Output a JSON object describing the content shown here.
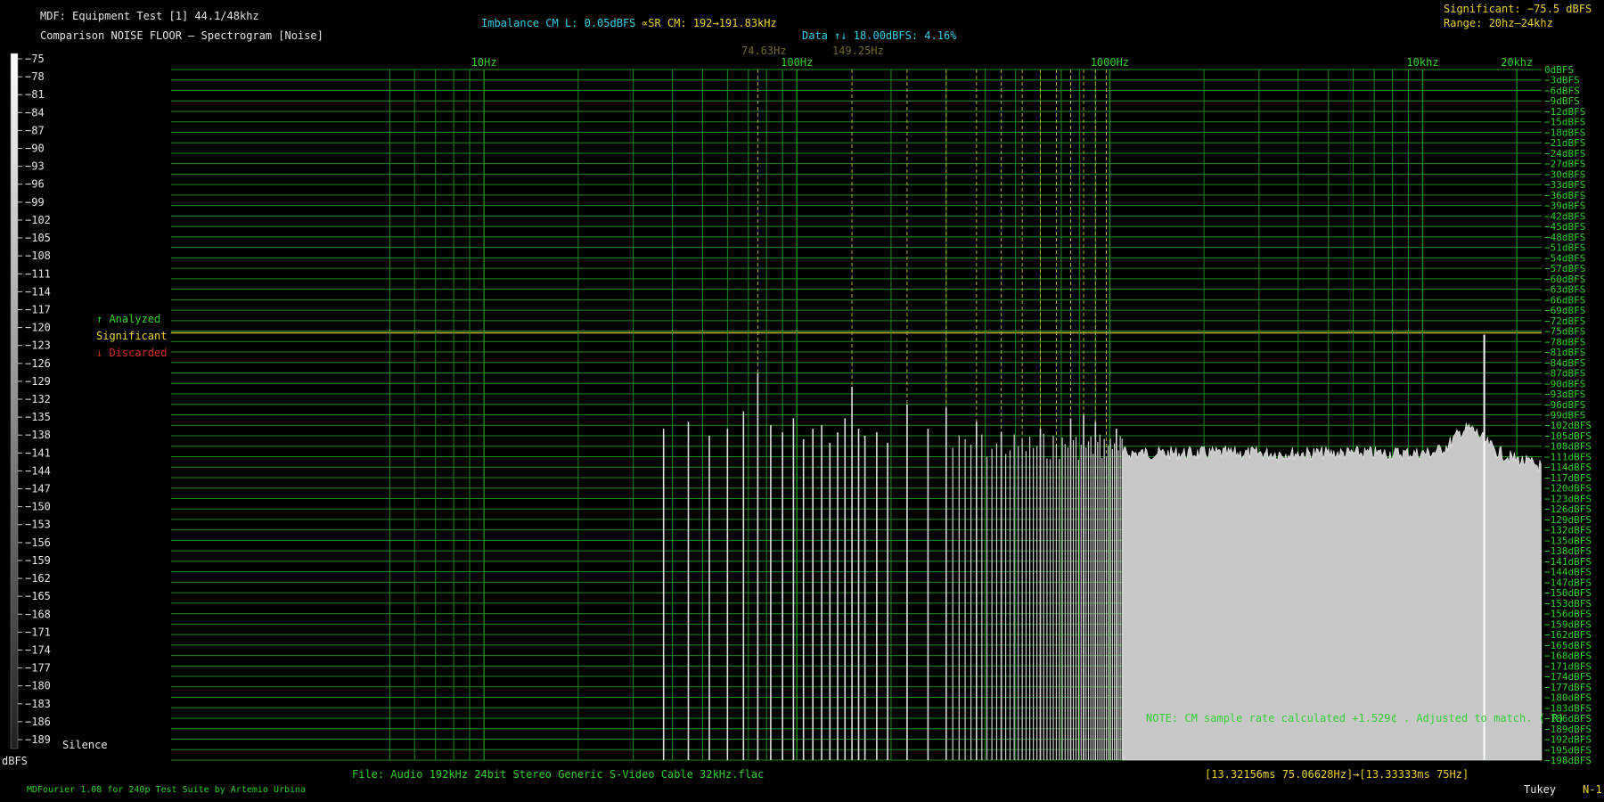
{
  "header": {
    "line1": "MDF: Equipment Test [1] 44.1/48khz",
    "line2": "Comparison NOISE FLOOR – Spectrogram [Noise]",
    "imbalance": "Imbalance CM L: 0.05dBFS",
    "sr_cm": "∝SR CM: 192→191.83kHz",
    "data_note": "Data ↑↓ 18.00dBFS: 4.16%",
    "significant": "Significant: −75.5 dBFS",
    "range": "Range: 20hz–24khz",
    "marker1": "74.63Hz",
    "marker2": "149.25Hz"
  },
  "legend": {
    "analyzed": "↑ Analyzed",
    "significant": "Significant",
    "discarded": "↓ Discarded",
    "silence": "Silence",
    "unit": "dBFS"
  },
  "footer": {
    "file": "File: Audio  192kHz 24bit Stereo Generic S-Video Cable 32kHz.flac",
    "range": "[13.32156ms 75.06628Hz]→[13.33333ms 75Hz]",
    "credit": "MDFourier 1.08 for 240p Test Suite by Artemio Urbina",
    "window": "Tukey",
    "n": "N-1",
    "note": "NOTE: CM sample rate calculated +1.529¢ . Adjusted to match. (-R)"
  },
  "colors": {
    "background": "#000000",
    "grid": "#1f8a1f",
    "axis_text": "#2ed12e",
    "significant_line": "#c8b428",
    "marker": "#b8b038",
    "spectrum": "#c8c8c8"
  },
  "chart_data": {
    "type": "bar",
    "title": "Comparison NOISE FLOOR – Spectrogram [Noise]",
    "x_scale": "log",
    "x_range_hz": [
      1,
      24000
    ],
    "x_ticks": [
      {
        "hz": 10,
        "label": "10Hz"
      },
      {
        "hz": 100,
        "label": "100Hz"
      },
      {
        "hz": 1000,
        "label": "1000Hz"
      },
      {
        "hz": 10000,
        "label": "10khz"
      },
      {
        "hz": 20000,
        "label": "20khz"
      }
    ],
    "y_range_dbfs": [
      -198,
      0
    ],
    "y_step_dbfs": 3,
    "significant_level_dbfs": -75.5,
    "marker_lines_hz": [
      75,
      150,
      225,
      300,
      375,
      450,
      525,
      600,
      675,
      750,
      825,
      900,
      975
    ],
    "color_scale_ticks": [
      "-75",
      "-78",
      "-81",
      "-84",
      "-87",
      "-90",
      "-93",
      "-96",
      "-99",
      "-102",
      "-105",
      "-108",
      "-111",
      "-114",
      "-117",
      "-120",
      "-123",
      "-126",
      "-129",
      "-132",
      "-135",
      "-138",
      "-141",
      "-144",
      "-147",
      "-150",
      "-153",
      "-156",
      "-159",
      "-162",
      "-165",
      "-168",
      "-171",
      "-174",
      "-177",
      "-180",
      "-183",
      "-186",
      "-189"
    ],
    "harmonic_peaks": [
      {
        "hz": 37.5,
        "dbfs": -103
      },
      {
        "hz": 45,
        "dbfs": -101
      },
      {
        "hz": 52.5,
        "dbfs": -105
      },
      {
        "hz": 60,
        "dbfs": -103
      },
      {
        "hz": 67.5,
        "dbfs": -98
      },
      {
        "hz": 75,
        "dbfs": -87
      },
      {
        "hz": 82.5,
        "dbfs": -102
      },
      {
        "hz": 90,
        "dbfs": -104
      },
      {
        "hz": 97.5,
        "dbfs": -100
      },
      {
        "hz": 105,
        "dbfs": -106
      },
      {
        "hz": 112.5,
        "dbfs": -103
      },
      {
        "hz": 120,
        "dbfs": -102
      },
      {
        "hz": 127.5,
        "dbfs": -107
      },
      {
        "hz": 135,
        "dbfs": -104
      },
      {
        "hz": 142.5,
        "dbfs": -100
      },
      {
        "hz": 150,
        "dbfs": -91
      },
      {
        "hz": 157.5,
        "dbfs": -103
      },
      {
        "hz": 165,
        "dbfs": -105
      },
      {
        "hz": 180,
        "dbfs": -104
      },
      {
        "hz": 195,
        "dbfs": -107
      },
      {
        "hz": 225,
        "dbfs": -96
      },
      {
        "hz": 262.5,
        "dbfs": -103
      },
      {
        "hz": 300,
        "dbfs": -97
      },
      {
        "hz": 375,
        "dbfs": -101
      },
      {
        "hz": 450,
        "dbfs": -104
      },
      {
        "hz": 600,
        "dbfs": -103
      },
      {
        "hz": 750,
        "dbfs": -100
      },
      {
        "hz": 825,
        "dbfs": -99
      },
      {
        "hz": 900,
        "dbfs": -101
      },
      {
        "hz": 1050,
        "dbfs": -103
      }
    ],
    "noise_floor_start_hz": 1100,
    "noise_floor_dbfs": -108,
    "noise_bump": {
      "hz": 14000,
      "dbfs": -101
    },
    "peak": {
      "hz": 15734,
      "dbfs": -76
    }
  }
}
